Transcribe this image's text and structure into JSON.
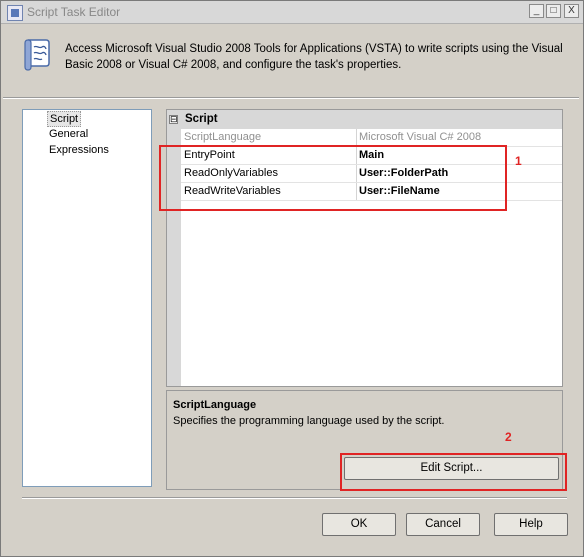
{
  "window": {
    "title": "Script Task Editor"
  },
  "title_buttons": {
    "minimize": "_",
    "maximize": "□",
    "close": "X"
  },
  "header": {
    "description": "Access Microsoft Visual Studio 2008 Tools for Applications (VSTA) to write scripts using the Visual Basic 2008 or Visual C# 2008, and configure the task's properties."
  },
  "nav": {
    "items": [
      {
        "label": "Script",
        "selected": true
      },
      {
        "label": "General",
        "selected": false
      },
      {
        "label": "Expressions",
        "selected": false
      }
    ]
  },
  "grid": {
    "category": "Script",
    "expander": "⊟",
    "properties": [
      {
        "name": "ScriptLanguage",
        "value": "Microsoft Visual C# 2008",
        "disabled": true
      },
      {
        "name": "EntryPoint",
        "value": "Main",
        "disabled": false
      },
      {
        "name": "ReadOnlyVariables",
        "value": "User::FolderPath",
        "disabled": false
      },
      {
        "name": "ReadWriteVariables",
        "value": "User::FileName",
        "disabled": false
      }
    ]
  },
  "description_panel": {
    "title": "ScriptLanguage",
    "text": "Specifies the programming language used by the script."
  },
  "buttons": {
    "edit_script": "Edit Script...",
    "ok": "OK",
    "cancel": "Cancel",
    "help": "Help"
  },
  "annotations": {
    "one": "1",
    "two": "2",
    "color": "#e02424"
  }
}
